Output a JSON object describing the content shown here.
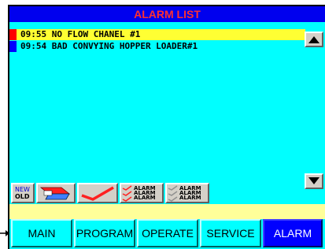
{
  "title": "ALARM LIST",
  "alarms": [
    {
      "text": "09:55 NO FLOW CHANEL #1",
      "marker_color": "#ff0000",
      "highlighted": true
    },
    {
      "text": "09:54 BAD CONVYING HOPPER LOADER#1",
      "marker_color": "#0000ff",
      "highlighted": false
    }
  ],
  "toolbar": {
    "new_label": "NEW",
    "old_label": "OLD",
    "alarm_stack_text": "ALARM",
    "ack_stack_text": "ALARM"
  },
  "nav": [
    {
      "label": "MAIN",
      "active": false
    },
    {
      "label": "PROGRAM",
      "active": false
    },
    {
      "label": "OPERATE",
      "active": false
    },
    {
      "label": "SERVICE",
      "active": false
    },
    {
      "label": "ALARM",
      "active": true
    }
  ],
  "icons": {
    "scroll_up": "triangle-up-icon",
    "scroll_down": "triangle-down-icon",
    "hopper": "hopper-icon",
    "check": "checkmark-icon",
    "side_pointer": "arrow-right-icon"
  },
  "colors": {
    "background": "#00ffff",
    "title_bar": "#0000ee",
    "title_text": "#ff3030",
    "highlight_row": "#ffff33",
    "active_nav": "#0000ff"
  }
}
